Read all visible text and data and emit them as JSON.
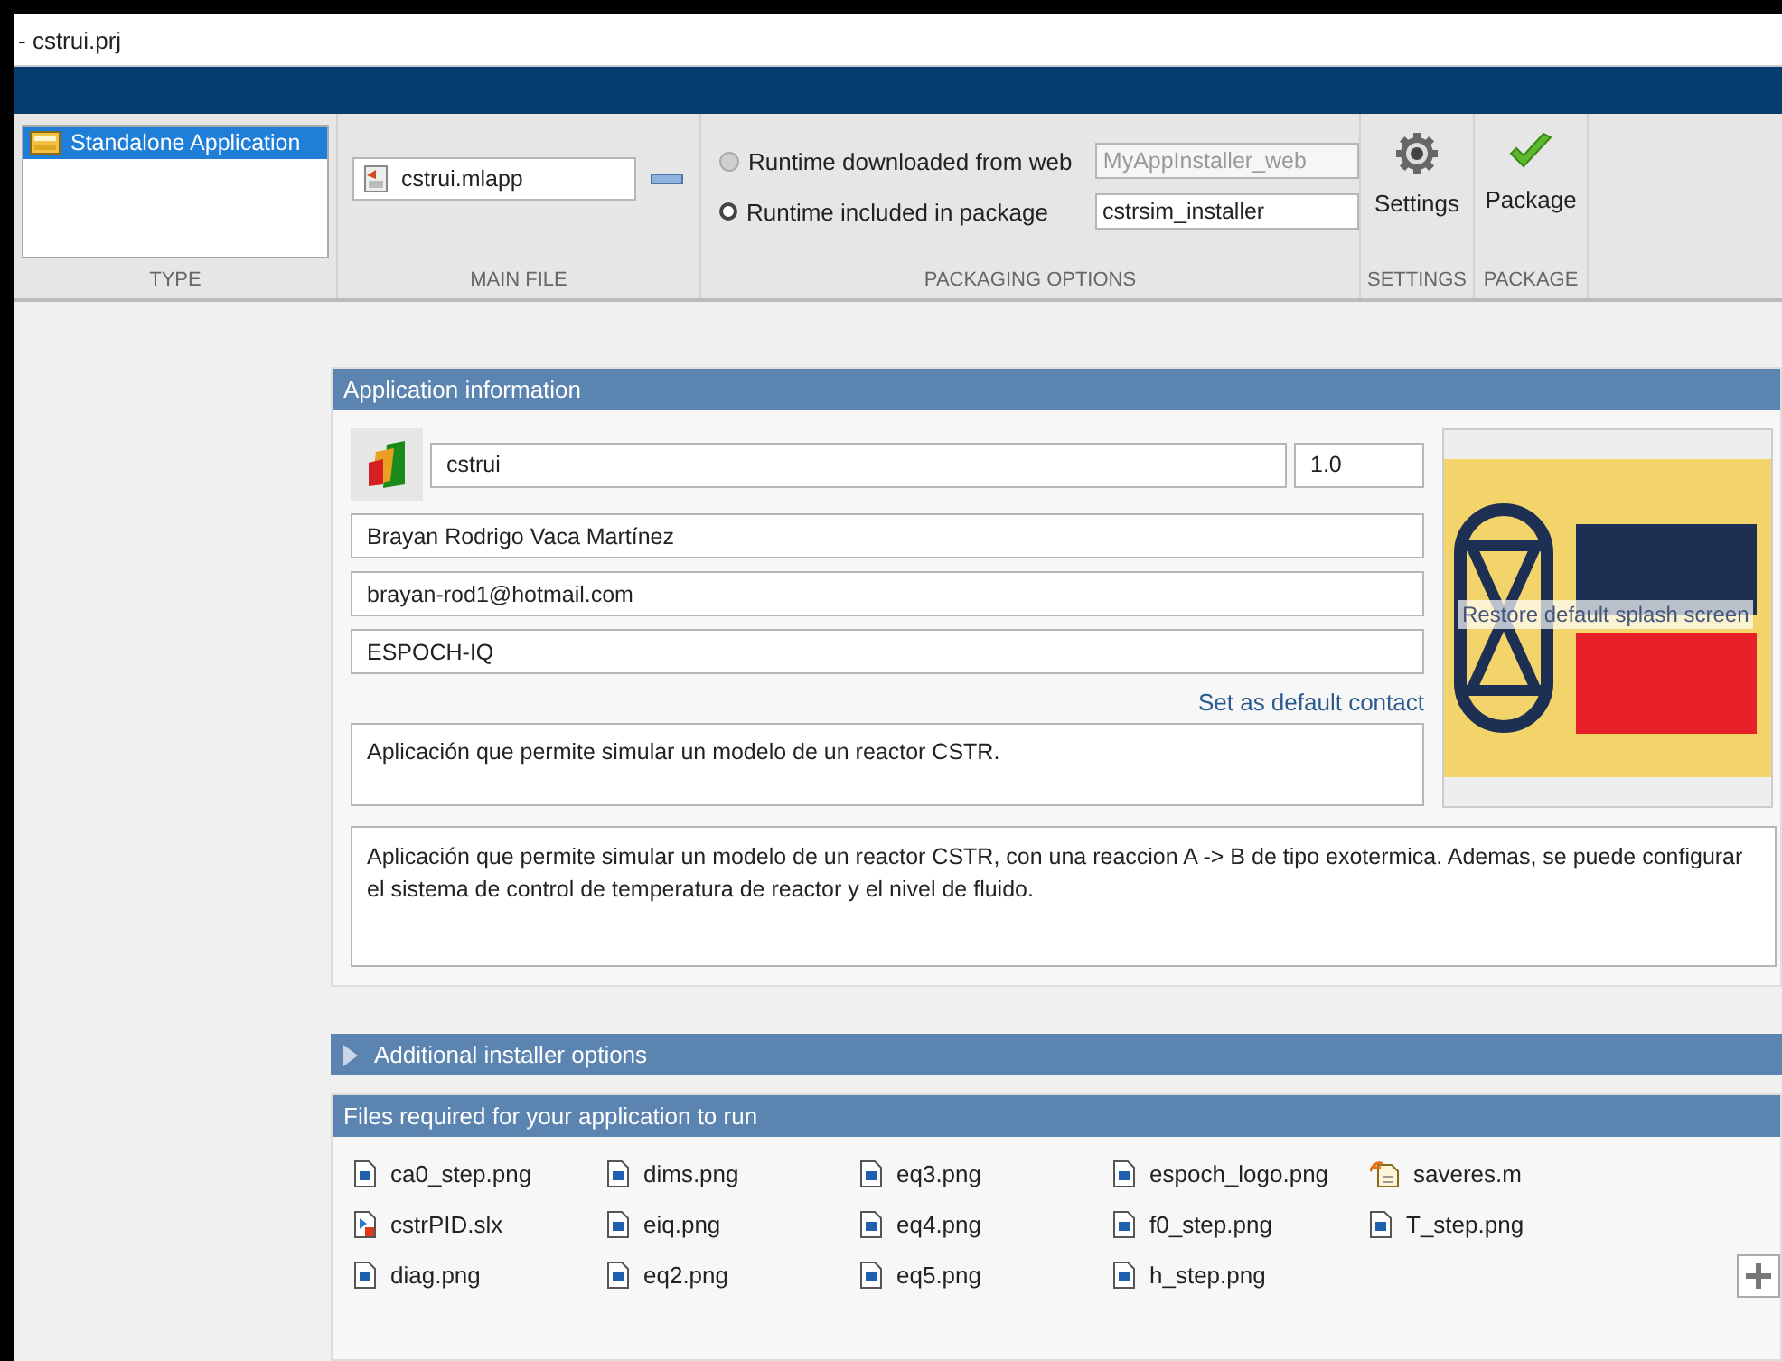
{
  "window": {
    "title": "- cstrui.prj"
  },
  "toolstrip": {
    "type": {
      "items": [
        {
          "label": "Standalone Application",
          "selected": true
        }
      ],
      "caption": "TYPE"
    },
    "main_file": {
      "value": "cstrui.mlapp",
      "caption": "MAIN FILE"
    },
    "packaging_options": {
      "options": [
        {
          "label": "Runtime downloaded from web",
          "selected": false,
          "value": "MyAppInstaller_web"
        },
        {
          "label": "Runtime included in package",
          "selected": true,
          "value": "cstrsim_installer"
        }
      ],
      "caption": "PACKAGING OPTIONS"
    },
    "settings": {
      "label": "Settings",
      "caption": "SETTINGS"
    },
    "package": {
      "label": "Package",
      "caption": "PACKAGE"
    }
  },
  "app_info": {
    "header": "Application information",
    "name": "cstrui",
    "version": "1.0",
    "author": "Brayan Rodrigo Vaca Martínez",
    "email": "brayan-rod1@hotmail.com",
    "company": "ESPOCH-IQ",
    "default_contact_link": "Set as default contact",
    "summary": "Aplicación que permite simular un modelo de un reactor CSTR.",
    "description": "Aplicación que permite simular un modelo de un reactor CSTR, con una reaccion A -> B de tipo exotermica. Ademas, se puede configurar el sistema de control de temperatura de reactor y el nivel de fluido.",
    "splash_tooltip": "Restore default splash screen"
  },
  "additional_options": {
    "header": "Additional installer options",
    "expanded": false
  },
  "files": {
    "header": "Files required for your application to run",
    "items": [
      {
        "name": "ca0_step.png",
        "kind": "image"
      },
      {
        "name": "cstrPID.slx",
        "kind": "model"
      },
      {
        "name": "diag.png",
        "kind": "image"
      },
      {
        "name": "dims.png",
        "kind": "image"
      },
      {
        "name": "eiq.png",
        "kind": "image"
      },
      {
        "name": "eq2.png",
        "kind": "image"
      },
      {
        "name": "eq3.png",
        "kind": "image"
      },
      {
        "name": "eq4.png",
        "kind": "image"
      },
      {
        "name": "eq5.png",
        "kind": "image"
      },
      {
        "name": "espoch_logo.png",
        "kind": "image"
      },
      {
        "name": "f0_step.png",
        "kind": "image"
      },
      {
        "name": "h_step.png",
        "kind": "image"
      },
      {
        "name": "saveres.m",
        "kind": "script"
      },
      {
        "name": "T_step.png",
        "kind": "image"
      }
    ]
  }
}
